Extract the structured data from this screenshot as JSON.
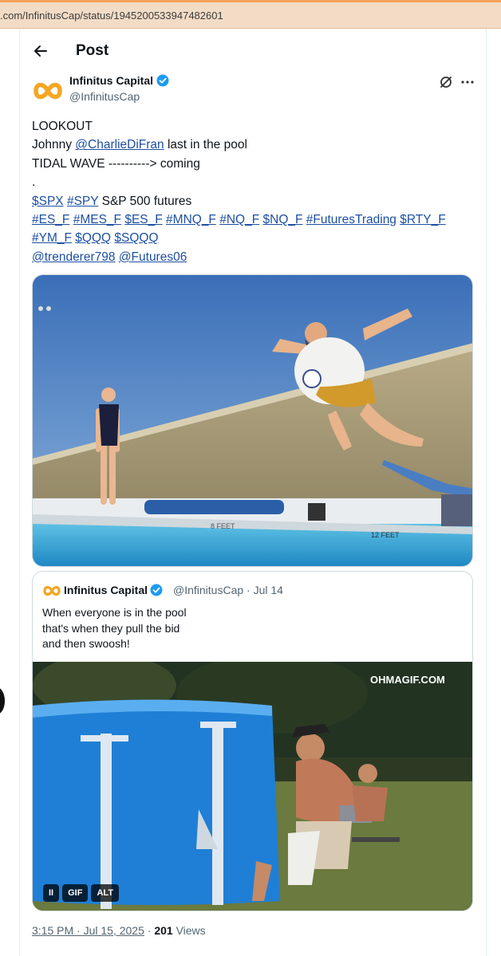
{
  "browser": {
    "url": ".com/InfinitusCap/status/1945200533947482601"
  },
  "header": {
    "title": "Post"
  },
  "author": {
    "name": "Infinitus Capital",
    "handle": "@InfinitusCap"
  },
  "tweet": {
    "line1": "LOOKOUT",
    "line2_pre": "Johnny ",
    "line2_mention": "@CharlieDiFran",
    "line2_post": " last in the pool",
    "line3": "TIDAL WAVE ----------> coming",
    "line4": ".",
    "tags_row1": [
      "$SPX",
      "#SPY"
    ],
    "row1_text": "S&P 500 futures",
    "tags_row2": [
      "#ES_F",
      "#MES_F",
      "$ES_F",
      "#MNQ_F",
      "#NQ_F",
      "$NQ_F",
      "#FuturesTrading",
      "$RTY_F"
    ],
    "tags_row3": [
      "#YM_F",
      "$QQQ",
      "$SQQQ"
    ],
    "mentions_row4": [
      "@trenderer798",
      "@Futures06"
    ]
  },
  "main_media": {
    "pool_sign_left": "8 FEET",
    "pool_sign_right": "12 FEET"
  },
  "quote": {
    "name": "Infinitus Capital",
    "meta": "@InfinitusCap · Jul 14",
    "text_lines": [
      "When everyone is in the pool",
      "that's when they pull the bid",
      "and then swoosh!"
    ],
    "watermark": "OHMAGIF.COM",
    "controls": {
      "pause": "II",
      "gif": "GIF",
      "alt": "ALT"
    }
  },
  "footer": {
    "time": "3:15 PM · Jul 15, 2025",
    "separator": " · ",
    "views_count": "201",
    "views_label": " Views"
  },
  "colors": {
    "link": "#1d4fa3",
    "verified": "#1d9bf0",
    "logo": "#f5a623"
  }
}
